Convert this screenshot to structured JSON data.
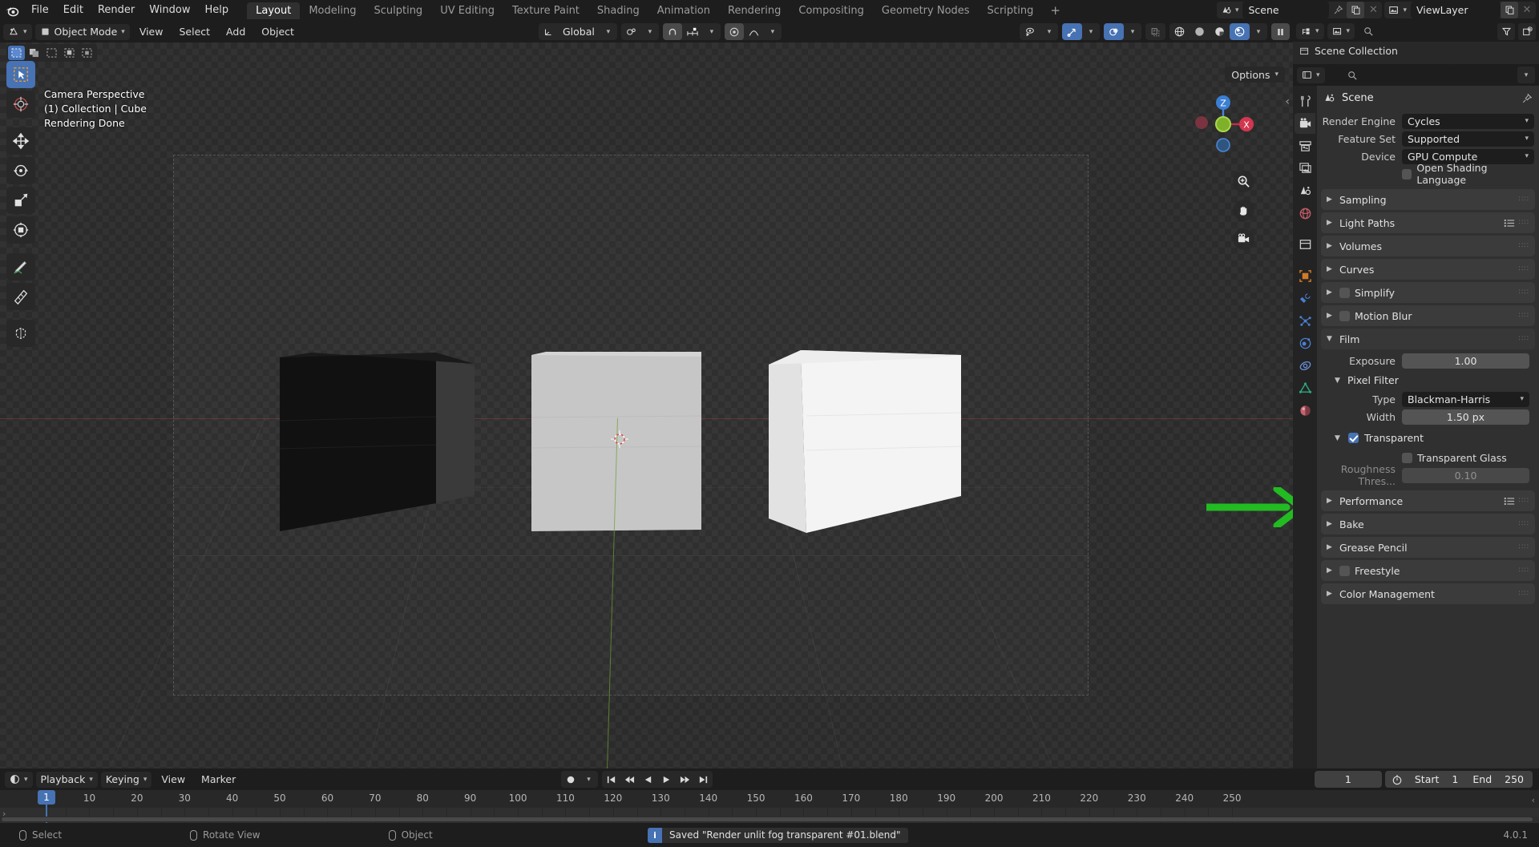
{
  "app": {
    "logo_icon": "blender-logo",
    "version": "4.0.1"
  },
  "topbar": {
    "menus": [
      "File",
      "Edit",
      "Render",
      "Window",
      "Help"
    ],
    "workspace_tabs": [
      {
        "label": "Layout",
        "active": true
      },
      {
        "label": "Modeling",
        "active": false
      },
      {
        "label": "Sculpting",
        "active": false
      },
      {
        "label": "UV Editing",
        "active": false
      },
      {
        "label": "Texture Paint",
        "active": false
      },
      {
        "label": "Shading",
        "active": false
      },
      {
        "label": "Animation",
        "active": false
      },
      {
        "label": "Rendering",
        "active": false
      },
      {
        "label": "Compositing",
        "active": false
      },
      {
        "label": "Geometry Nodes",
        "active": false
      },
      {
        "label": "Scripting",
        "active": false
      }
    ],
    "add_workspace_label": "+",
    "scene_browse_icon": "scene-icon",
    "scene_name": "Scene",
    "scene_pin_icon": "pin-icon",
    "scene_new_icon": "duplicate-icon",
    "scene_unlink_icon": "close-icon",
    "viewlayer_browse_icon": "viewlayer-icon",
    "viewlayer_name": "ViewLayer",
    "viewlayer_new_icon": "duplicate-icon",
    "viewlayer_remove_icon": "close-icon"
  },
  "viewport": {
    "header": {
      "editor_type_icon": "editor-type-icon",
      "mode": "Object Mode",
      "menus": [
        "View",
        "Select",
        "Add",
        "Object"
      ],
      "transform_orientation": "Global",
      "snap_icon": "magnet-icon",
      "pivot_icon": "pivot-icon",
      "proportional_icon": "proportional-edit-icon",
      "proportional_falloff_icon": "falloff-curve-icon",
      "visibility_icon": "show-gizmo-icon",
      "gizmo_icon": "gizmo-icon",
      "overlays_icon": "overlays-icon",
      "xray_icon": "xray-icon",
      "shading_modes": [
        "wireframe",
        "solid",
        "material-preview",
        "rendered"
      ],
      "shading_active": "rendered",
      "pause_icon": "pause-icon",
      "options_label": "Options"
    },
    "info_lines": [
      "Camera Perspective",
      "(1) Collection | Cube",
      "Rendering Done"
    ],
    "mode_icons": [
      "select-box",
      "object-origins",
      "select-set",
      "select-extend",
      "select-subtract"
    ],
    "tools": [
      {
        "name": "tweak-select-tool",
        "active": true
      },
      {
        "name": "cursor-tool",
        "active": false
      },
      {
        "name": "move-tool",
        "active": false
      },
      {
        "name": "rotate-tool",
        "active": false
      },
      {
        "name": "scale-tool",
        "active": false
      },
      {
        "name": "transform-tool",
        "active": false
      },
      {
        "name": "annotate-tool",
        "active": false
      },
      {
        "name": "measure-tool",
        "active": false
      },
      {
        "name": "add-cube-tool",
        "active": false
      }
    ],
    "gizmo": {
      "z_label": "Z",
      "x_label": "X"
    },
    "nav_buttons": [
      "zoom-icon",
      "pan-hand-icon",
      "camera-view-icon"
    ],
    "annotation_arrow_color": "#22bb22"
  },
  "outliner": {
    "editor_icon": "outliner-icon",
    "display_mode_icon": "view-layer-icon",
    "filter_icon": "filter-icon",
    "new_collection_icon": "new-collection-icon",
    "search_placeholder": "",
    "root_item": "Scene Collection",
    "root_icon": "collection-icon"
  },
  "properties": {
    "header": {
      "editor_icon": "properties-icon",
      "search_placeholder": "",
      "search_icon": "search-icon",
      "options_chevron": "chevron-down-icon"
    },
    "tabs": [
      {
        "name": "tool-tab",
        "icon": "tool-icon",
        "active": false
      },
      {
        "name": "render-tab",
        "icon": "render-camera-icon",
        "active": true
      },
      {
        "name": "output-tab",
        "icon": "printer-icon",
        "active": false
      },
      {
        "name": "view-layer-tab",
        "icon": "images-icon",
        "active": false
      },
      {
        "name": "scene-tab",
        "icon": "scene-cone-icon",
        "active": false
      },
      {
        "name": "world-tab",
        "icon": "world-globe-icon",
        "active": false
      },
      {
        "name": "collection-tab",
        "icon": "collection-box-icon",
        "active": false
      },
      {
        "name": "object-tab",
        "icon": "object-square-icon",
        "active": false
      },
      {
        "name": "modifier-tab",
        "icon": "wrench-icon",
        "active": false
      },
      {
        "name": "particles-tab",
        "icon": "particles-icon",
        "active": false
      },
      {
        "name": "physics-tab",
        "icon": "physics-orbit-icon",
        "active": false
      },
      {
        "name": "constraints-tab",
        "icon": "constraint-icon",
        "active": false
      },
      {
        "name": "data-tab",
        "icon": "mesh-data-triangle-icon",
        "active": false
      },
      {
        "name": "material-tab",
        "icon": "material-sphere-icon",
        "active": false
      }
    ],
    "breadcrumb": {
      "icon": "scene-icon",
      "label": "Scene",
      "pin_icon": "pin-icon"
    },
    "fields": [
      {
        "label": "Render Engine",
        "value": "Cycles",
        "type": "dropdown"
      },
      {
        "label": "Feature Set",
        "value": "Supported",
        "type": "dropdown"
      },
      {
        "label": "Device",
        "value": "GPU Compute",
        "type": "dropdown"
      }
    ],
    "osl_checkbox": {
      "label": "Open Shading Language",
      "checked": false
    },
    "panels": [
      {
        "label": "Sampling",
        "open": false,
        "checkbox": null,
        "has_list_icon": false
      },
      {
        "label": "Light Paths",
        "open": false,
        "checkbox": null,
        "has_list_icon": true
      },
      {
        "label": "Volumes",
        "open": false,
        "checkbox": null,
        "has_list_icon": false
      },
      {
        "label": "Curves",
        "open": false,
        "checkbox": null,
        "has_list_icon": false
      },
      {
        "label": "Simplify",
        "open": false,
        "checkbox": false,
        "has_list_icon": false
      },
      {
        "label": "Motion Blur",
        "open": false,
        "checkbox": false,
        "has_list_icon": false
      }
    ],
    "film": {
      "label": "Film",
      "open": true,
      "exposure": {
        "label": "Exposure",
        "value": "1.00"
      },
      "pixel_filter": {
        "label": "Pixel Filter",
        "open": true,
        "type": {
          "label": "Type",
          "value": "Blackman-Harris"
        },
        "width": {
          "label": "Width",
          "value": "1.50 px"
        }
      },
      "transparent": {
        "label": "Transparent",
        "open": true,
        "checked": true,
        "transparent_glass": {
          "label": "Transparent Glass",
          "checked": false
        },
        "roughness_threshold": {
          "label": "Roughness Thres...",
          "value": "0.10",
          "enabled": false
        }
      }
    },
    "panels_bottom": [
      {
        "label": "Performance",
        "open": false,
        "checkbox": null,
        "has_list_icon": true
      },
      {
        "label": "Bake",
        "open": false,
        "checkbox": null,
        "has_list_icon": false
      },
      {
        "label": "Grease Pencil",
        "open": false,
        "checkbox": null,
        "has_list_icon": false
      },
      {
        "label": "Freestyle",
        "open": false,
        "checkbox": false,
        "has_list_icon": false
      },
      {
        "label": "Color Management",
        "open": false,
        "checkbox": null,
        "has_list_icon": false
      }
    ]
  },
  "timeline": {
    "editor_icon": "timeline-icon",
    "menus": [
      "Playback",
      "Keying",
      "View",
      "Marker"
    ],
    "auto_keying_icon": "record-icon",
    "transport_buttons": [
      "jump-to-start",
      "jump-prev-keyframe",
      "play-reverse",
      "play",
      "jump-next-keyframe",
      "jump-to-end"
    ],
    "current_frame": "1",
    "frame_clock_icon": "stopwatch-icon",
    "start_label": "Start",
    "start_value": "1",
    "end_label": "End",
    "end_value": "250",
    "ruler_ticks": [
      1,
      10,
      20,
      30,
      40,
      50,
      60,
      70,
      80,
      90,
      100,
      110,
      120,
      130,
      140,
      150,
      160,
      170,
      180,
      190,
      200,
      210,
      220,
      230,
      240,
      250
    ],
    "playhead_frame": "1"
  },
  "statusbar": {
    "items": [
      {
        "icon": "mouse-left-icon",
        "label": "Select"
      },
      {
        "icon": "mouse-middle-icon",
        "label": "Rotate View"
      },
      {
        "icon": "mouse-right-icon",
        "label": "Object"
      }
    ],
    "report": {
      "icon": "info-icon",
      "text": "Saved \"Render unlit fog transparent #01.blend\""
    },
    "version": "4.0.1"
  }
}
